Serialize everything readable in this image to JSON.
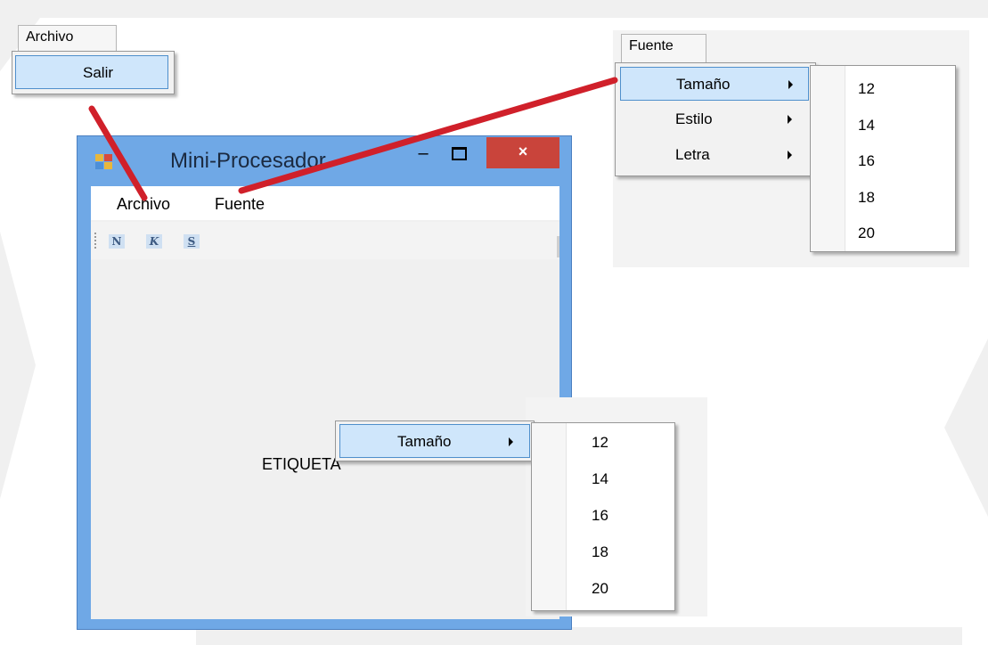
{
  "archivo_callout": {
    "menu_title": "Archivo",
    "items": [
      {
        "label": "Salir"
      }
    ]
  },
  "fuente_callout": {
    "menu_title": "Fuente",
    "items": [
      {
        "label": "Tamaño"
      },
      {
        "label": "Estilo"
      },
      {
        "label": "Letra"
      }
    ],
    "submenu_sizes": [
      "12",
      "14",
      "16",
      "18",
      "20"
    ]
  },
  "window": {
    "title": "Mini-Procesador",
    "minimize_glyph": "–",
    "close_glyph": "×",
    "menubar": [
      "Archivo",
      "Fuente"
    ],
    "toolbar": [
      {
        "label": "N",
        "icon": "bold-icon"
      },
      {
        "label": "K",
        "icon": "italic-icon"
      },
      {
        "label": "S",
        "icon": "underline-icon"
      }
    ],
    "label_text": "ETIQUETA"
  },
  "context_callout": {
    "item": "Tamaño",
    "sizes": [
      "12",
      "14",
      "16",
      "18",
      "20"
    ]
  },
  "colors": {
    "highlight": "#cfe6fb",
    "highlight_border": "#4f8fcc",
    "window_frame": "#6fa8e6",
    "close_button": "#c9443b",
    "connector": "#d0202a"
  }
}
